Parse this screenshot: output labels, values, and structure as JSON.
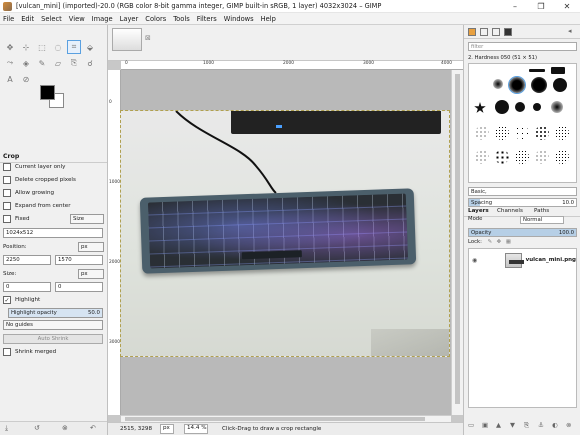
{
  "window": {
    "title": "[vulcan_mini] (imported)-20.0 (RGB color 8-bit gamma integer, GIMP built-in sRGB, 1 layer) 4032x3024 – GIMP",
    "controls": [
      "–",
      "❐",
      "✕"
    ]
  },
  "menu": [
    "File",
    "Edit",
    "Select",
    "View",
    "Image",
    "Layer",
    "Colors",
    "Tools",
    "Filters",
    "Windows",
    "Help"
  ],
  "tool_options": {
    "title": "Crop",
    "current_layer_only": "Current layer only",
    "delete_cropped": "Delete cropped pixels",
    "allow_growing": "Allow growing",
    "expand_center": "Expand from center",
    "fixed_label": "Fixed",
    "fixed_value": "Size",
    "size_value": "1024x512",
    "position_label": "Position:",
    "position_unit": "px",
    "position_x": "2250",
    "position_y": "1570",
    "size_label": "Size:",
    "size_unit": "px",
    "size_x": "0",
    "size_y": "0",
    "highlight": "Highlight",
    "highlight_opacity_label": "Highlight opacity",
    "highlight_opacity_value": "50.0",
    "guides": "No guides",
    "auto_shrink": "Auto Shrink",
    "shrink_merged": "Shrink merged"
  },
  "canvas": {
    "ruler_h": [
      "0",
      "1000",
      "2000",
      "3000",
      "4000"
    ],
    "ruler_v": [
      "0",
      "1000",
      "2000",
      "3000"
    ]
  },
  "status": {
    "coords": "2515, 3298",
    "unit": "px",
    "zoom": "14.4 %",
    "message": "Click-Drag to draw a crop rectangle"
  },
  "brushes": {
    "filter_placeholder": "filter",
    "selected_brush": "2. Hardness 050 (51 × 51)",
    "tag_select": "Basic,",
    "spacing_label": "Spacing",
    "spacing_value": "10.0",
    "spacing_fraction": 0.1
  },
  "layers": {
    "tabs": [
      "Layers",
      "Channels",
      "Paths"
    ],
    "mode_label": "Mode",
    "mode_value": "Normal",
    "opacity_label": "Opacity",
    "opacity_value": "100.0",
    "lock_label": "Lock:",
    "layer_name": "vulcan_mini.png"
  }
}
